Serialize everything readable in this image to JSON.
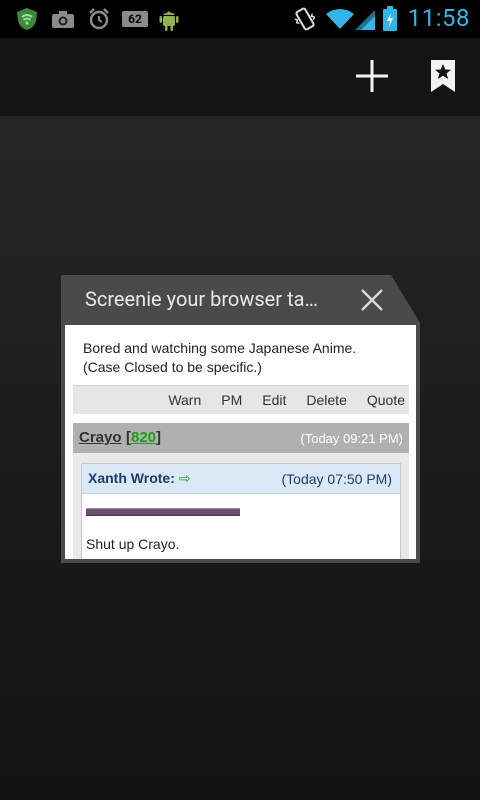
{
  "status_bar": {
    "battery_badge": "62",
    "time": "11:58",
    "icons": [
      "shield-icon",
      "camera-icon",
      "alarm-icon",
      "battery-badge-icon",
      "android-debug-icon",
      "vibrate-icon",
      "wifi-icon",
      "signal-icon",
      "battery-icon"
    ]
  },
  "action_bar": {
    "new_tab_icon": "plus-icon",
    "bookmarks_icon": "bookmark-star-icon"
  },
  "tab": {
    "title": "Screenie your browser ta…",
    "close_icon": "close-icon",
    "thumbnail": {
      "post_text_line1": "Bored and watching some Japanese Anime.",
      "post_text_line2": "(Case Closed to be specific.)",
      "actions": [
        "Warn",
        "PM",
        "Edit",
        "Delete",
        "Quote"
      ],
      "next_post": {
        "username": "Crayo",
        "rep_open": "[",
        "rep_value": "820",
        "rep_close": "]",
        "time": "(Today 09:21 PM)",
        "quote_author": "Xanth Wrote:",
        "quote_arrow": "⇨",
        "quote_time": "(Today 07:50 PM)",
        "text": "Shut up Crayo."
      }
    }
  },
  "colors": {
    "clock": "#33b5e5",
    "tab_header": "#4a4a4a",
    "quote_header": "#dbe9f7",
    "rep_green": "#1f9c1f"
  }
}
